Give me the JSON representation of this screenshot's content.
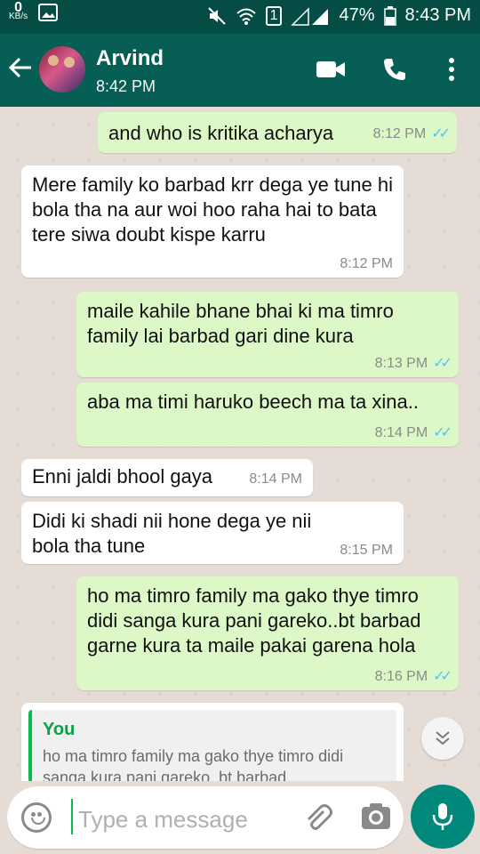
{
  "status_bar": {
    "kbs_value": "0",
    "kbs_unit": "KB/s",
    "sim": "1",
    "battery": "47%",
    "time": "8:43 PM"
  },
  "header": {
    "name": "Arvind",
    "last_seen": "8:42 PM"
  },
  "messages": [
    {
      "dir": "out",
      "text": "and who is kritika acharya",
      "time": "8:12 PM",
      "ticks": "✓✓"
    },
    {
      "dir": "in",
      "text": "Mere family ko barbad krr dega ye tune hi bola tha na aur woi hoo raha hai to bata tere siwa doubt kispe karru",
      "time": "8:12 PM"
    },
    {
      "dir": "out",
      "text": "maile kahile bhane bhai ki ma timro family lai barbad gari dine kura",
      "time": "8:13 PM",
      "ticks": "✓✓"
    },
    {
      "dir": "out",
      "text": "aba ma timi haruko beech ma ta xina..",
      "time": "8:14 PM",
      "ticks": "✓✓"
    },
    {
      "dir": "in",
      "text": "Enni jaldi bhool gaya",
      "time": "8:14 PM"
    },
    {
      "dir": "in",
      "text": "Didi ki shadi nii hone dega ye nii bola tha tune",
      "time": "8:15 PM"
    },
    {
      "dir": "out",
      "text": "ho ma timro family ma gako thye timro didi sanga kura pani gareko..bt barbad garne kura ta maile pakai garena hola",
      "time": "8:16 PM",
      "ticks": "✓✓"
    }
  ],
  "quoted_reply": {
    "author": "You",
    "text": "ho ma timro family ma gako thye timro didi sanga kura pani gareko..bt barbad"
  },
  "input": {
    "placeholder": "Type a message"
  },
  "colors": {
    "status_bar": "#054d44",
    "app_bar": "#075e54",
    "outgoing_bubble": "#dcf8c6",
    "incoming_bubble": "#ffffff",
    "read_ticks": "#4fc3f7",
    "mic_button": "#00897b",
    "quote_accent": "#07bc4c"
  },
  "icons": [
    "back-arrow-icon",
    "video-call-icon",
    "phone-icon",
    "more-vert-icon",
    "emoji-icon",
    "attach-icon",
    "camera-icon",
    "mic-icon",
    "chevron-double-down-icon",
    "image-icon",
    "mute-icon",
    "wifi-icon",
    "signal-icon",
    "battery-icon"
  ]
}
